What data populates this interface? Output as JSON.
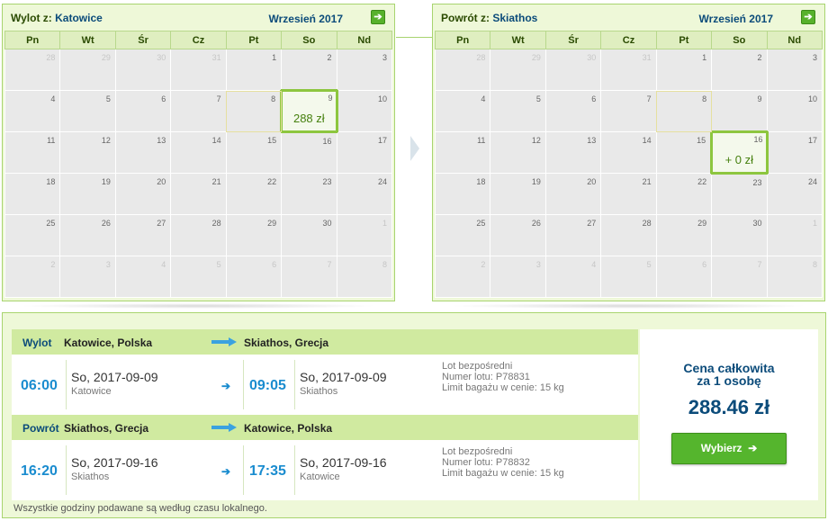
{
  "departure_calendar": {
    "title_label": "Wylot z:",
    "title_city": "Katowice",
    "month": "Wrzesień 2017",
    "weekdays": [
      "Pn",
      "Wt",
      "Śr",
      "Cz",
      "Pt",
      "So",
      "Nd"
    ],
    "weeks": [
      [
        "28",
        "29",
        "30",
        "31",
        "1",
        "2",
        "3"
      ],
      [
        "4",
        "5",
        "6",
        "7",
        "8",
        "9",
        "10"
      ],
      [
        "11",
        "12",
        "13",
        "14",
        "15",
        "16",
        "17"
      ],
      [
        "18",
        "19",
        "20",
        "21",
        "22",
        "23",
        "24"
      ],
      [
        "25",
        "26",
        "27",
        "28",
        "29",
        "30",
        "1"
      ],
      [
        "2",
        "3",
        "4",
        "5",
        "6",
        "7",
        "8"
      ]
    ],
    "selected_price": "288 zł"
  },
  "return_calendar": {
    "title_label": "Powrót z:",
    "title_city": "Skiathos",
    "month": "Wrzesień 2017",
    "weekdays": [
      "Pn",
      "Wt",
      "Śr",
      "Cz",
      "Pt",
      "So",
      "Nd"
    ],
    "weeks": [
      [
        "28",
        "29",
        "30",
        "31",
        "1",
        "2",
        "3"
      ],
      [
        "4",
        "5",
        "6",
        "7",
        "8",
        "9",
        "10"
      ],
      [
        "11",
        "12",
        "13",
        "14",
        "15",
        "16",
        "17"
      ],
      [
        "18",
        "19",
        "20",
        "21",
        "22",
        "23",
        "24"
      ],
      [
        "25",
        "26",
        "27",
        "28",
        "29",
        "30",
        "1"
      ],
      [
        "2",
        "3",
        "4",
        "5",
        "6",
        "7",
        "8"
      ]
    ],
    "selected_price": "+ 0 zł"
  },
  "outbound": {
    "label": "Wylot",
    "from": "Katowice, Polska",
    "to": "Skiathos, Grecja",
    "dep_time": "06:00",
    "dep_date": "So, 2017-09-09",
    "dep_city": "Katowice",
    "arr_time": "09:05",
    "arr_date": "So, 2017-09-09",
    "arr_city": "Skiathos",
    "info1": "Lot bezpośredni",
    "info2": "Numer lotu: P78831",
    "info3": "Limit bagażu w cenie: 15 kg"
  },
  "inbound": {
    "label": "Powrót",
    "from": "Skiathos, Grecja",
    "to": "Katowice, Polska",
    "dep_time": "16:20",
    "dep_date": "So, 2017-09-16",
    "dep_city": "Skiathos",
    "arr_time": "17:35",
    "arr_date": "So, 2017-09-16",
    "arr_city": "Katowice",
    "info1": "Lot bezpośredni",
    "info2": "Numer lotu: P78832",
    "info3": "Limit bagażu w cenie: 15 kg"
  },
  "price": {
    "label_line1": "Cena całkowita",
    "label_line2": "za 1 osobę",
    "total": "288.46 zł",
    "button": "Wybierz"
  },
  "footnote": "Wszystkie godziny podawane są według czasu lokalnego.",
  "colors": {
    "accent_green": "#55b52d",
    "time_blue": "#1a8ccf",
    "title_navy": "#0b4b7a"
  }
}
